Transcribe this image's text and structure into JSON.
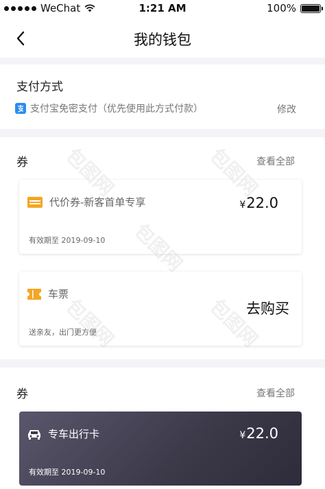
{
  "status_bar": {
    "carrier": "WeChat",
    "time": "1:21 AM",
    "battery": "100%"
  },
  "nav": {
    "title": "我的钱包",
    "back_icon": "chevron-left-icon"
  },
  "payment": {
    "section_title": "支付方式",
    "method_icon": "alipay-icon",
    "method_label": "支付宝免密支付（优先使用此方式付款）",
    "modify_label": "修改"
  },
  "coupons": {
    "section_title": "券",
    "view_all_label": "查看全部",
    "items": [
      {
        "icon": "ticket-icon",
        "title": "代价券-新客首单专享",
        "subtitle": "有效期至 2019-09-10",
        "currency": "¥",
        "amount": "22.0"
      },
      {
        "icon": "train-ticket-icon",
        "title": "车票",
        "subtitle": "送亲友，出门更方便",
        "action_label": "去购买"
      }
    ]
  },
  "cards": {
    "section_title": "券",
    "view_all_label": "查看全部",
    "item": {
      "icon": "car-icon",
      "title": "专车出行卡",
      "subtitle": "有效期至 2019-09-10",
      "currency": "¥",
      "amount": "22.0"
    }
  },
  "colors": {
    "accent_orange": "#f5a623",
    "alipay_blue": "#2a8cf2",
    "separator": "#f4f3f7",
    "dark_card": "#3b3848"
  },
  "watermark": "包图网"
}
